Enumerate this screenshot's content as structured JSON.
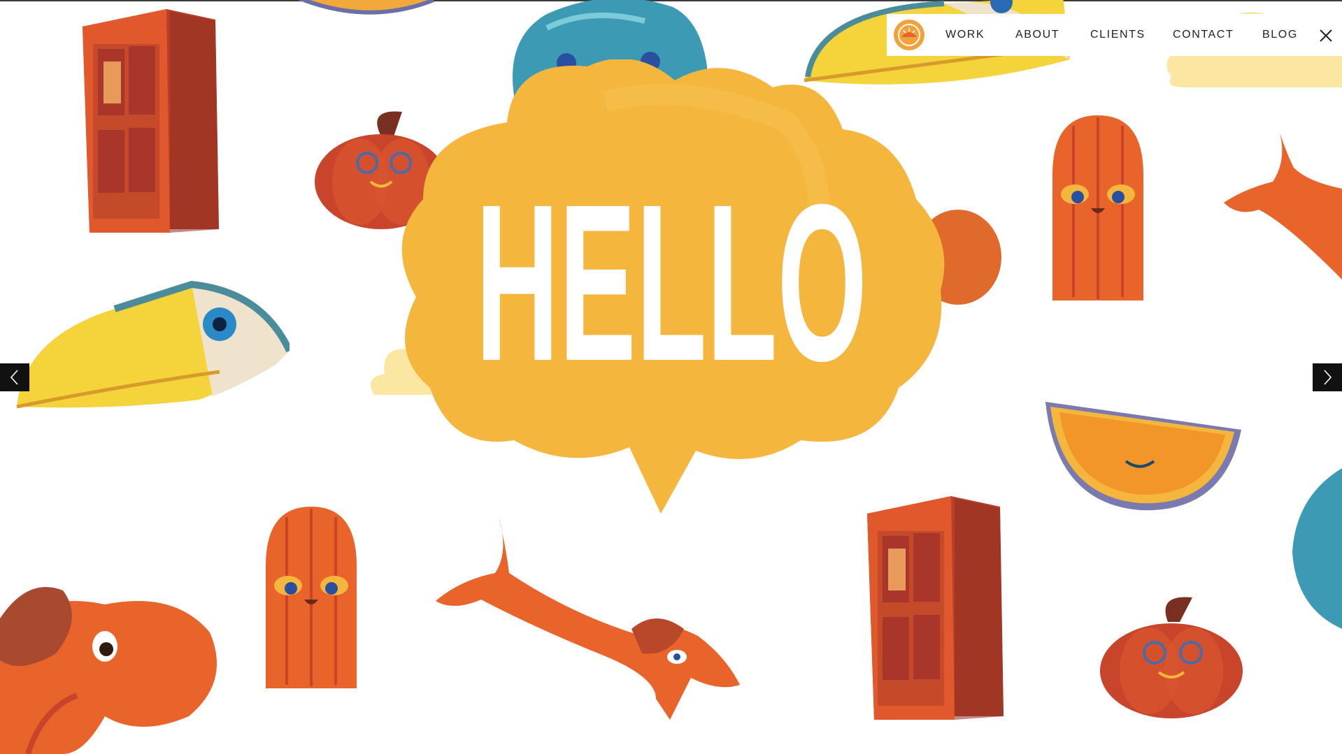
{
  "nav": {
    "items": [
      {
        "label": "WORK"
      },
      {
        "label": "ABOUT"
      },
      {
        "label": "CLIENTS"
      },
      {
        "label": "CONTACT"
      },
      {
        "label": "BLOG"
      }
    ],
    "logo_icon": "sun-logo-icon",
    "close_icon": "close-icon"
  },
  "hero": {
    "headline": "HELLO"
  },
  "carousel": {
    "prev_icon": "chevron-left-icon",
    "next_icon": "chevron-right-icon"
  },
  "colors": {
    "bubble": "#F4B63C",
    "orange": "#E8642A",
    "rust": "#C8442A",
    "yellow": "#F4D43A",
    "teal": "#3C9AB4",
    "nav_bg": "#FFFFFF",
    "arrow_bg": "#111111"
  }
}
